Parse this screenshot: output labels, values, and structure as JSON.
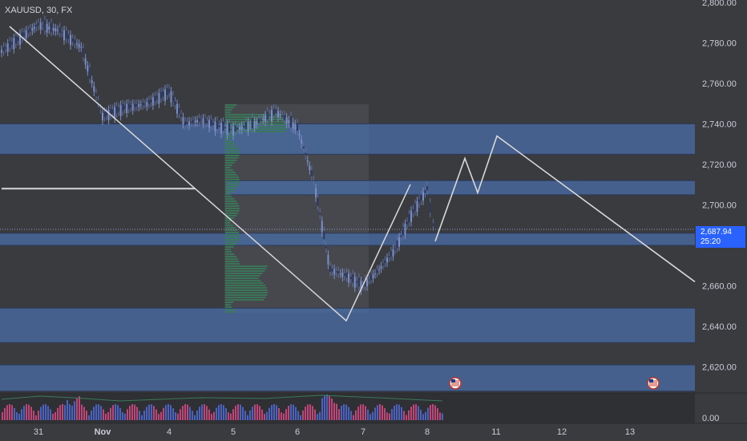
{
  "symbol": {
    "title": "XAUUSD, 30, FX"
  },
  "price_tag": {
    "price": "2,687.94",
    "countdown": "25:20"
  },
  "colors": {
    "background": "#3a3b3f",
    "zone": "#4a6da8",
    "candle_up": "#7a8fc8",
    "candle_down": "#2f3a5e",
    "drawing_line": "#d8d8d8",
    "profile": "#3a7a5a",
    "accent": "#2962ff"
  },
  "icons": [
    "us-flag-event-icon",
    "us-flag-event-icon"
  ],
  "chart_data": [
    {
      "type": "candlestick",
      "title": "XAUUSD, 30, FX",
      "x_tick_labels": [
        "31",
        "Nov",
        "4",
        "5",
        "6",
        "7",
        "8",
        "11",
        "12",
        "13"
      ],
      "y_ticks": [
        2800,
        2780,
        2760,
        2740,
        2720,
        2700,
        2660,
        2640,
        2620
      ],
      "y_tick_labels": [
        "2,800.00",
        "2,780.00",
        "2,760.00",
        "2,740.00",
        "2,720.00",
        "2,700.00",
        "2,660.00",
        "2,640.00",
        "2,620.00"
      ],
      "ylim": [
        2607,
        2801
      ],
      "last_price": 2687.94,
      "zones": [
        {
          "low": 2725,
          "high": 2740
        },
        {
          "low": 2705,
          "high": 2712
        },
        {
          "low": 2680,
          "high": 2686
        },
        {
          "low": 2632,
          "high": 2649
        },
        {
          "low": 2608,
          "high": 2621
        }
      ],
      "price_path": [
        {
          "x": "Oct 30",
          "y": 2776
        },
        {
          "x": "Oct 31",
          "y": 2789
        },
        {
          "x": "Oct 31",
          "y": 2786
        },
        {
          "x": "Oct 31",
          "y": 2778
        },
        {
          "x": "Nov 1",
          "y": 2744
        },
        {
          "x": "Nov 1",
          "y": 2748
        },
        {
          "x": "Nov 1",
          "y": 2750
        },
        {
          "x": "Nov 4",
          "y": 2756
        },
        {
          "x": "Nov 4",
          "y": 2740
        },
        {
          "x": "Nov 4",
          "y": 2742
        },
        {
          "x": "Nov 4",
          "y": 2739
        },
        {
          "x": "Nov 5",
          "y": 2737
        },
        {
          "x": "Nov 5",
          "y": 2740
        },
        {
          "x": "Nov 5",
          "y": 2746
        },
        {
          "x": "Nov 6",
          "y": 2738
        },
        {
          "x": "Nov 6",
          "y": 2712
        },
        {
          "x": "Nov 6",
          "y": 2668
        },
        {
          "x": "Nov 6",
          "y": 2665
        },
        {
          "x": "Nov 7",
          "y": 2660
        },
        {
          "x": "Nov 7",
          "y": 2668
        },
        {
          "x": "Nov 7",
          "y": 2678
        },
        {
          "x": "Nov 7",
          "y": 2695
        },
        {
          "x": "Nov 8",
          "y": 2708
        },
        {
          "x": "Nov 8",
          "y": 2698
        },
        {
          "x": "Nov 8",
          "y": 2690
        },
        {
          "x": "Nov 8",
          "y": 2687.94
        }
      ],
      "projection_path": [
        {
          "x": "Nov 8",
          "y": 2682
        },
        {
          "x": "Nov 8",
          "y": 2723
        },
        {
          "x": "Nov 11",
          "y": 2706
        },
        {
          "x": "Nov 11",
          "y": 2734
        },
        {
          "x": "Nov 13",
          "y": 2662
        }
      ],
      "horizontal_line": {
        "y": 2708,
        "from": "Oct 30",
        "to": "Nov 4"
      },
      "volume_axis_label": "0.00"
    }
  ]
}
